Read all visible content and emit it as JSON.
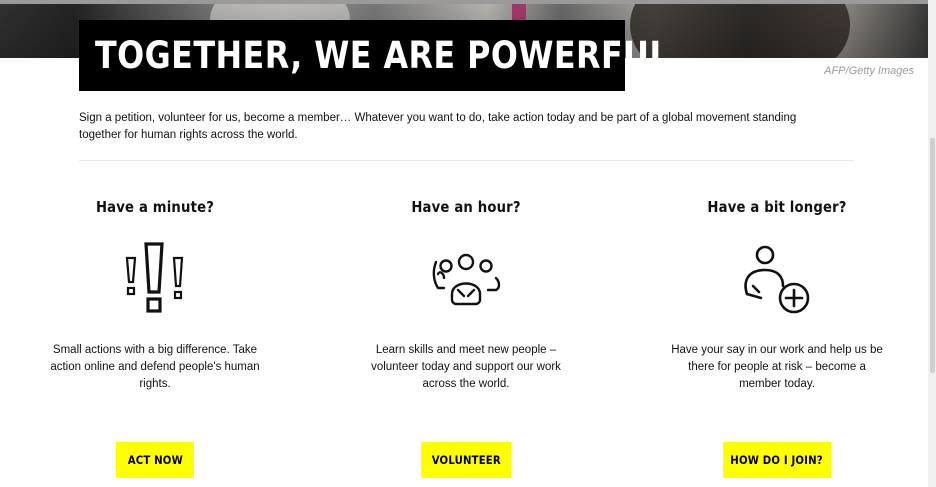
{
  "hero": {
    "headline": "TOGETHER, WE ARE POWERFUL",
    "credit": "AFP/Getty Images"
  },
  "intro": "Sign a petition, volunteer for us, become a member… Whatever you want to do, take action today and be part of a global movement standing together for human rights across the world.",
  "columns": [
    {
      "title": "Have a minute?",
      "icon": "exclamation-marks-icon",
      "description": "Small actions with a big difference. Take action online and defend people's human rights.",
      "button": "ACT NOW"
    },
    {
      "title": "Have an hour?",
      "icon": "group-people-icon",
      "description": "Learn skills and meet new people – volunteer today and support our work across the world.",
      "button": "VOLUNTEER"
    },
    {
      "title": "Have a bit longer?",
      "icon": "person-plus-icon",
      "description": "Have your say in our work and help us be there for people at risk – become a member today.",
      "button": "HOW DO I JOIN?"
    }
  ],
  "colors": {
    "accent": "#ffff00",
    "headline_bg": "#000000"
  }
}
